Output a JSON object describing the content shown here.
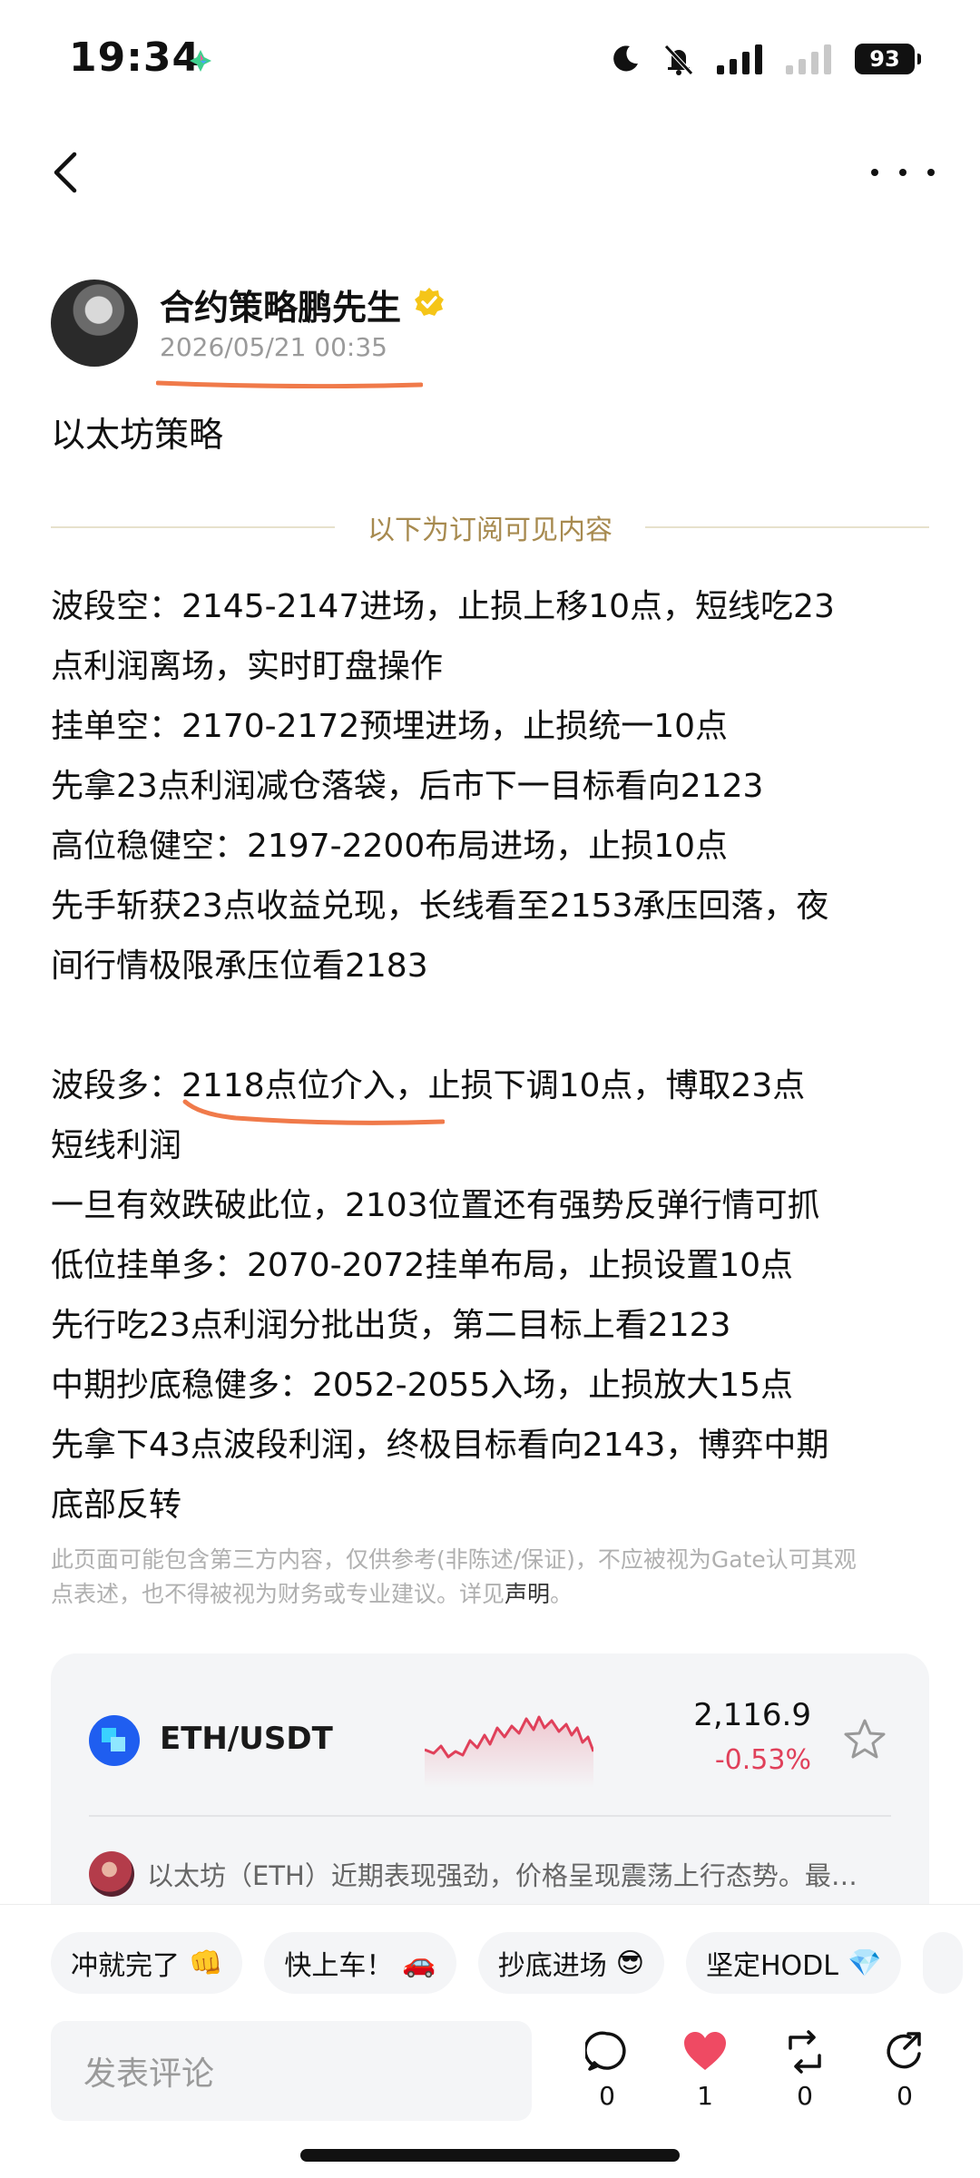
{
  "status_bar": {
    "time": "19:34",
    "battery": "93"
  },
  "author": {
    "name": "合约策略鹏先生",
    "date": "2026/05/21 00:35"
  },
  "post": {
    "title": "以太坊策略",
    "divider_text": "以下为订阅可见内容",
    "lines": [
      "波段空：2145-2147进场，止损上移10点，短线吃23",
      "点利润离场，实时盯盘操作",
      "挂单空：2170-2172预埋进场，止损统一10点",
      "先拿23点利润减仓落袋，后市下一目标看向2123",
      "高位稳健空：2197-2200布局进场，止损10点",
      "先手斩获23点收益兑现，长线看至2153承压回落，夜",
      "间行情极限承压位看2183",
      "",
      "波段多：2118点位介入，止损下调10点，博取23点",
      "短线利润",
      "一旦有效跌破此位，2103位置还有强势反弹行情可抓",
      "低位挂单多：2070-2072挂单布局，止损设置10点",
      "先行吃23点利润分批出货，第二目标上看2123",
      "中期抄底稳健多：2052-2055入场，止损放大15点",
      "先拿下43点波段利润，终极目标看向2143，博弈中期",
      "底部反转"
    ],
    "disclaimer_line1": "此页面可能包含第三方内容，仅供参考(非陈述/保证)，不应被视为Gate认可其观",
    "disclaimer_line2": "点表述，也不得被视为财务或专业建议。详见",
    "disclaimer_link": "声明",
    "disclaimer_end": "。"
  },
  "market": {
    "pair": "ETH/USDT",
    "price": "2,116.9",
    "change": "-0.53%",
    "ai_summary": "以太坊（ETH）近期表现强劲，价格呈现震荡上行态势。最…",
    "colors": {
      "down": "#e0405a",
      "coin": "#1f5ef0"
    }
  },
  "reactions": {
    "chips": [
      {
        "label": "冲就完了",
        "emoji": "👊"
      },
      {
        "label": "快上车！",
        "emoji": "🚗"
      },
      {
        "label": "抄底进场",
        "emoji": "😎"
      },
      {
        "label": "坚定HODL",
        "emoji": "💎"
      },
      {
        "label": "",
        "emoji": ""
      }
    ]
  },
  "comment": {
    "placeholder": "发表评论"
  },
  "actions": {
    "comments": "0",
    "likes": "1",
    "reposts": "0",
    "shares": "0"
  }
}
